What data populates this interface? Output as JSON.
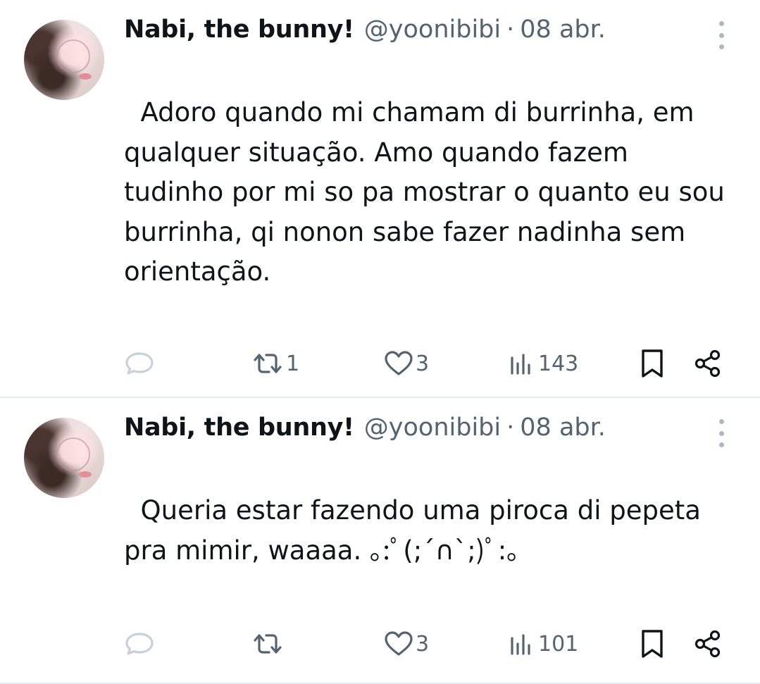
{
  "tweets": [
    {
      "name": "Nabi, the bunny!",
      "handle": "@yoonibibi",
      "separator": "·",
      "date": "08 abr.",
      "text_lines": [
        "  Adoro quando mi chamam di burrinha, em",
        "qualquer situação. Amo quando fazem",
        "tudinho por mi so pa mostrar o quanto eu sou",
        "burrinha, qi nonon sabe fazer nadinha sem",
        "orientação."
      ],
      "retweets": "1",
      "likes": "3",
      "views": "143"
    },
    {
      "name": "Nabi, the bunny!",
      "handle": "@yoonibibi",
      "separator": "·",
      "date": "08 abr.",
      "text_lines": [
        "  Queria estar fazendo uma piroca di pepeta",
        "pra mimir, waaaa. ｡:ﾟ(;´∩`;)ﾟ:｡"
      ],
      "retweets": "",
      "likes": "3",
      "views": "101"
    }
  ],
  "icons": {
    "reply": "reply-icon",
    "retweet": "retweet-icon",
    "like": "heart-icon",
    "views": "views-chart-icon",
    "bookmark": "bookmark-icon",
    "share": "share-icon",
    "more": "more-options-icon"
  },
  "colors": {
    "text": "#0f1419",
    "secondary": "#536471",
    "divider": "#e6ecf0",
    "reply_icon": "#c4d2dc"
  }
}
